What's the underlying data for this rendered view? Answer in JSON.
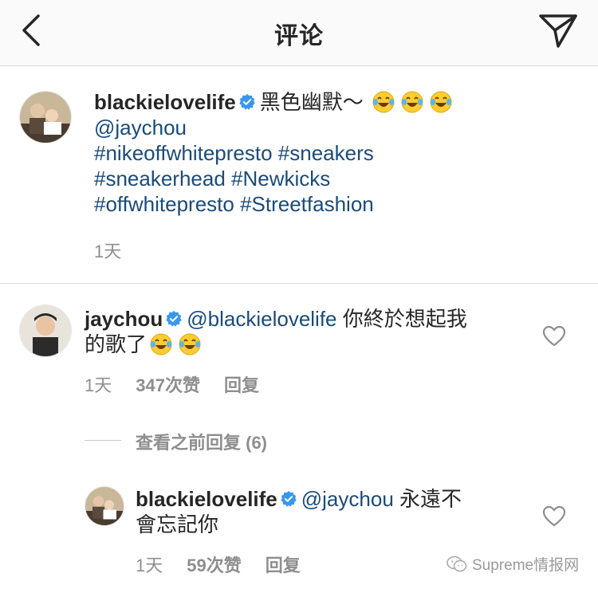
{
  "header": {
    "title": "评论"
  },
  "caption": {
    "username": "blackielovelife",
    "text": "黑色幽默～",
    "mention": "@jaychou",
    "hashtags_line1": "#nikeoffwhitepresto #sneakers",
    "hashtags_line2": "#sneakerhead #Newkicks",
    "hashtags_line3": "#offwhitepresto #Streetfashion",
    "time": "1天"
  },
  "comment1": {
    "username": "jaychou",
    "mention": "@blackielovelife",
    "text_line1": "你終於想起我",
    "text_line2": "的歌了",
    "time": "1天",
    "likes": "347次赞",
    "reply": "回复"
  },
  "view_previous": "查看之前回复 (6)",
  "comment2": {
    "username": "blackielovelife",
    "mention": "@jaychou",
    "text_line1": "永遠不",
    "text_line2": "會忘記你",
    "time": "1天",
    "likes": "59次赞",
    "reply": "回复"
  },
  "watermark": "Supreme情报网",
  "colors": {
    "link": "#1a4b7a",
    "verified": "#3897f0",
    "muted": "#8e8e8e"
  },
  "icons": [
    "back-chevron-icon",
    "send-direct-icon",
    "verified-badge-icon",
    "tears-of-joy-emoji-icon",
    "heart-outline-icon",
    "wechat-icon"
  ]
}
